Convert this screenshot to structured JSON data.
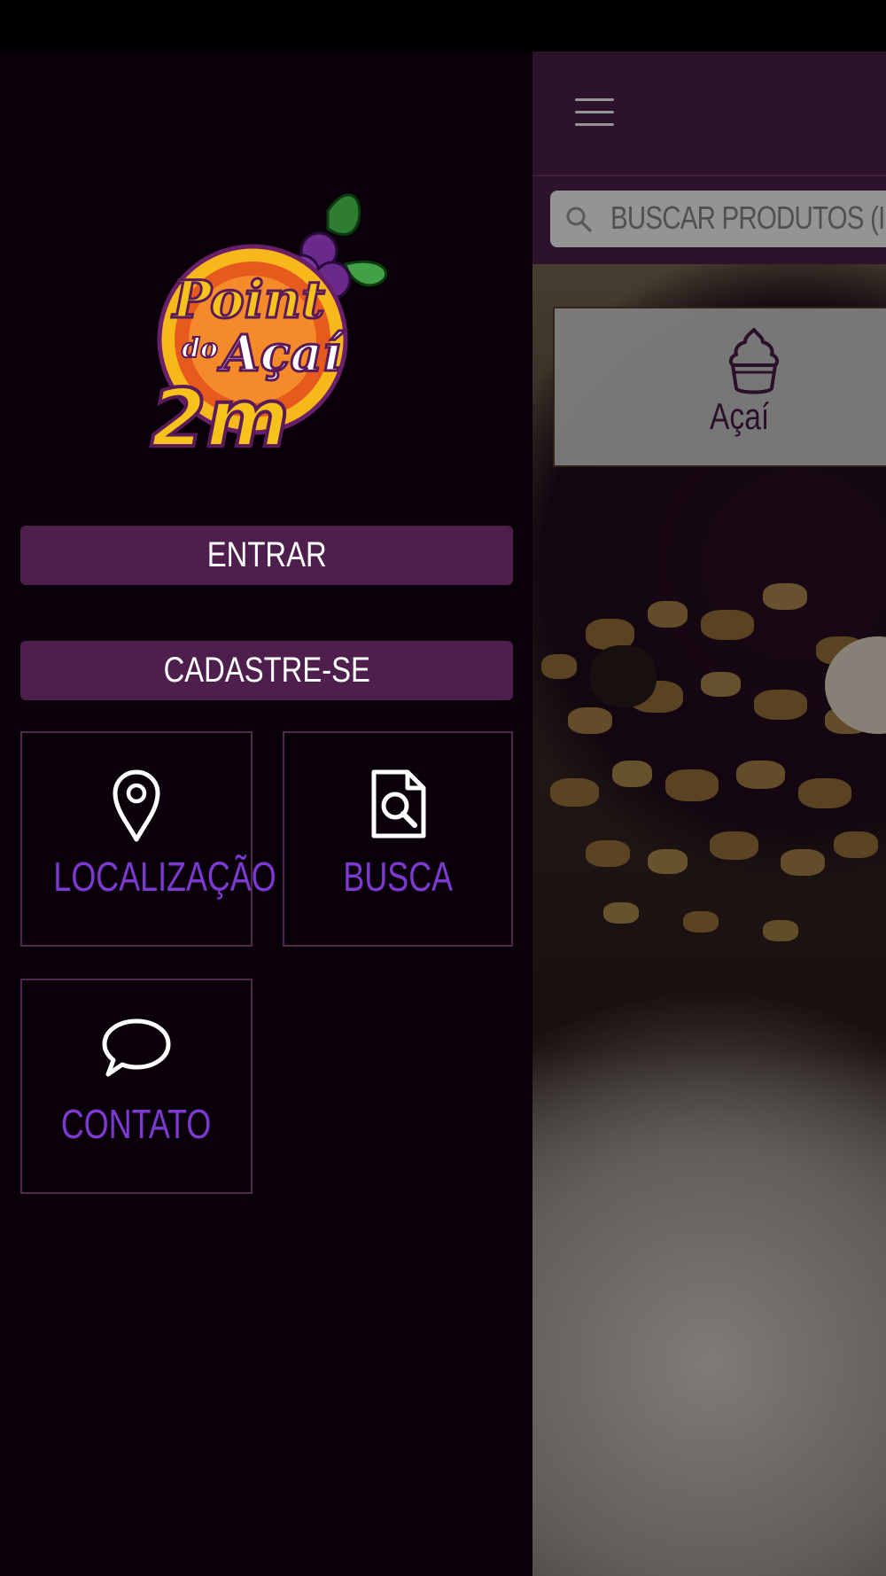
{
  "colors": {
    "brand_purple": "#4e1f4d",
    "drawer_bg": "#0a0009",
    "tile_label": "#7d3ad3"
  },
  "app": {
    "brand": {
      "line1": "Point",
      "line2": "do",
      "line3": "Açaí",
      "line4": "2m"
    }
  },
  "drawer": {
    "enter_label": "ENTRAR",
    "signup_label": "CADASTRE-SE",
    "tiles": [
      {
        "label": "LOCALIZAÇÃO",
        "icon": "map-pin-icon"
      },
      {
        "label": "BUSCA",
        "icon": "document-search-icon"
      },
      {
        "label": "CONTATO",
        "icon": "speech-bubble-icon"
      }
    ]
  },
  "main": {
    "menu_icon": "hamburger-menu-icon",
    "search": {
      "placeholder": "BUSCAR PRODUTOS (I"
    },
    "categories": [
      {
        "label": "Açaí",
        "icon": "ice-cream-cup-icon"
      }
    ]
  }
}
